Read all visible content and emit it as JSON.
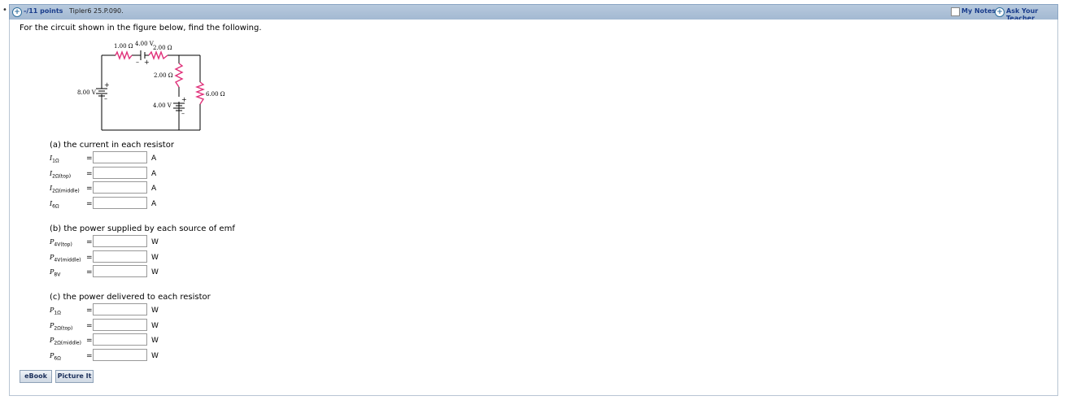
{
  "header": {
    "points": "-/11 points",
    "problem_id": "Tipler6 25.P.090.",
    "my_notes": "My Notes",
    "ask_teacher": "Ask Your Teacher"
  },
  "intro": "For the circuit shown in the figure below, find the following.",
  "circuit": {
    "r1": "1.00 Ω",
    "v_top": "4.00 V",
    "r2_top": "2.00 Ω",
    "r2_mid": "2.00 Ω",
    "v_left": "8.00 V",
    "r6": "6.00 Ω",
    "v_mid": "4.00 V",
    "plus": "+",
    "minus": "–"
  },
  "part_a": {
    "title": "(a) the current in each resistor",
    "rows": [
      {
        "sym": "I",
        "sub": "1Ω",
        "unit": "A"
      },
      {
        "sym": "I",
        "sub": "2Ω(top)",
        "unit": "A"
      },
      {
        "sym": "I",
        "sub": "2Ω(middle)",
        "unit": "A"
      },
      {
        "sym": "I",
        "sub": "6Ω",
        "unit": "A"
      }
    ]
  },
  "part_b": {
    "title": "(b) the power supplied by each source of emf",
    "rows": [
      {
        "sym": "P",
        "sub": "4V(top)",
        "unit": "W"
      },
      {
        "sym": "P",
        "sub": "4V(middle)",
        "unit": "W"
      },
      {
        "sym": "P",
        "sub": "8V",
        "unit": "W"
      }
    ]
  },
  "part_c": {
    "title": "(c) the power delivered to each resistor",
    "rows": [
      {
        "sym": "P",
        "sub": "1Ω",
        "unit": "W"
      },
      {
        "sym": "P",
        "sub": "2Ω(top)",
        "unit": "W"
      },
      {
        "sym": "P",
        "sub": "2Ω(middle)",
        "unit": "W"
      },
      {
        "sym": "P",
        "sub": "6Ω",
        "unit": "W"
      }
    ]
  },
  "buttons": {
    "ebook": "eBook",
    "picture_it": "Picture It"
  },
  "equals": "=",
  "colors": {
    "resistor": "#e0307a",
    "header_bg": "#a9bed6",
    "link": "#1a3d8c"
  }
}
